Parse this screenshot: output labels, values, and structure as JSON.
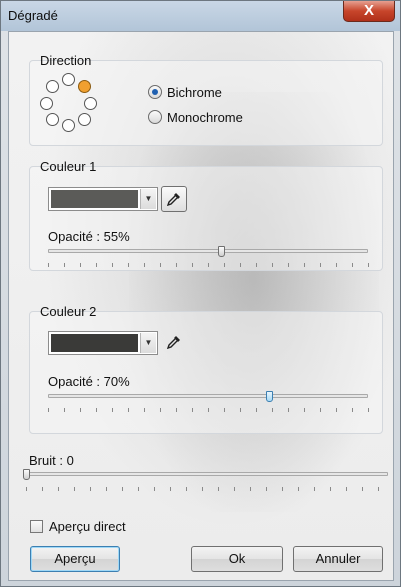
{
  "window": {
    "title": "Dégradé",
    "close_label": "X"
  },
  "direction": {
    "legend": "Direction",
    "options": [
      "Bichrome",
      "Monochrome"
    ],
    "selected": "Bichrome",
    "dot_selected_index": 1
  },
  "color1": {
    "legend": "Couleur 1",
    "swatch_color": "#5b5b58",
    "opacity_label": "Opacité : 55%",
    "opacity_value": 55
  },
  "color2": {
    "legend": "Couleur 2",
    "swatch_color": "#3a3a38",
    "opacity_label": "Opacité : 70%",
    "opacity_value": 70
  },
  "noise": {
    "label": "Bruit : 0",
    "value": 0
  },
  "preview_checkbox": {
    "label": "Aperçu direct",
    "checked": false
  },
  "buttons": {
    "preview": "Aperçu",
    "ok": "Ok",
    "cancel": "Annuler"
  },
  "icons": {
    "close": "close-icon",
    "eyedropper": "eyedropper-icon",
    "dropdown": "chevron-down-icon"
  },
  "colors": {
    "accent_dot": "#f0a030",
    "radio_fill": "#1e5fb0"
  }
}
